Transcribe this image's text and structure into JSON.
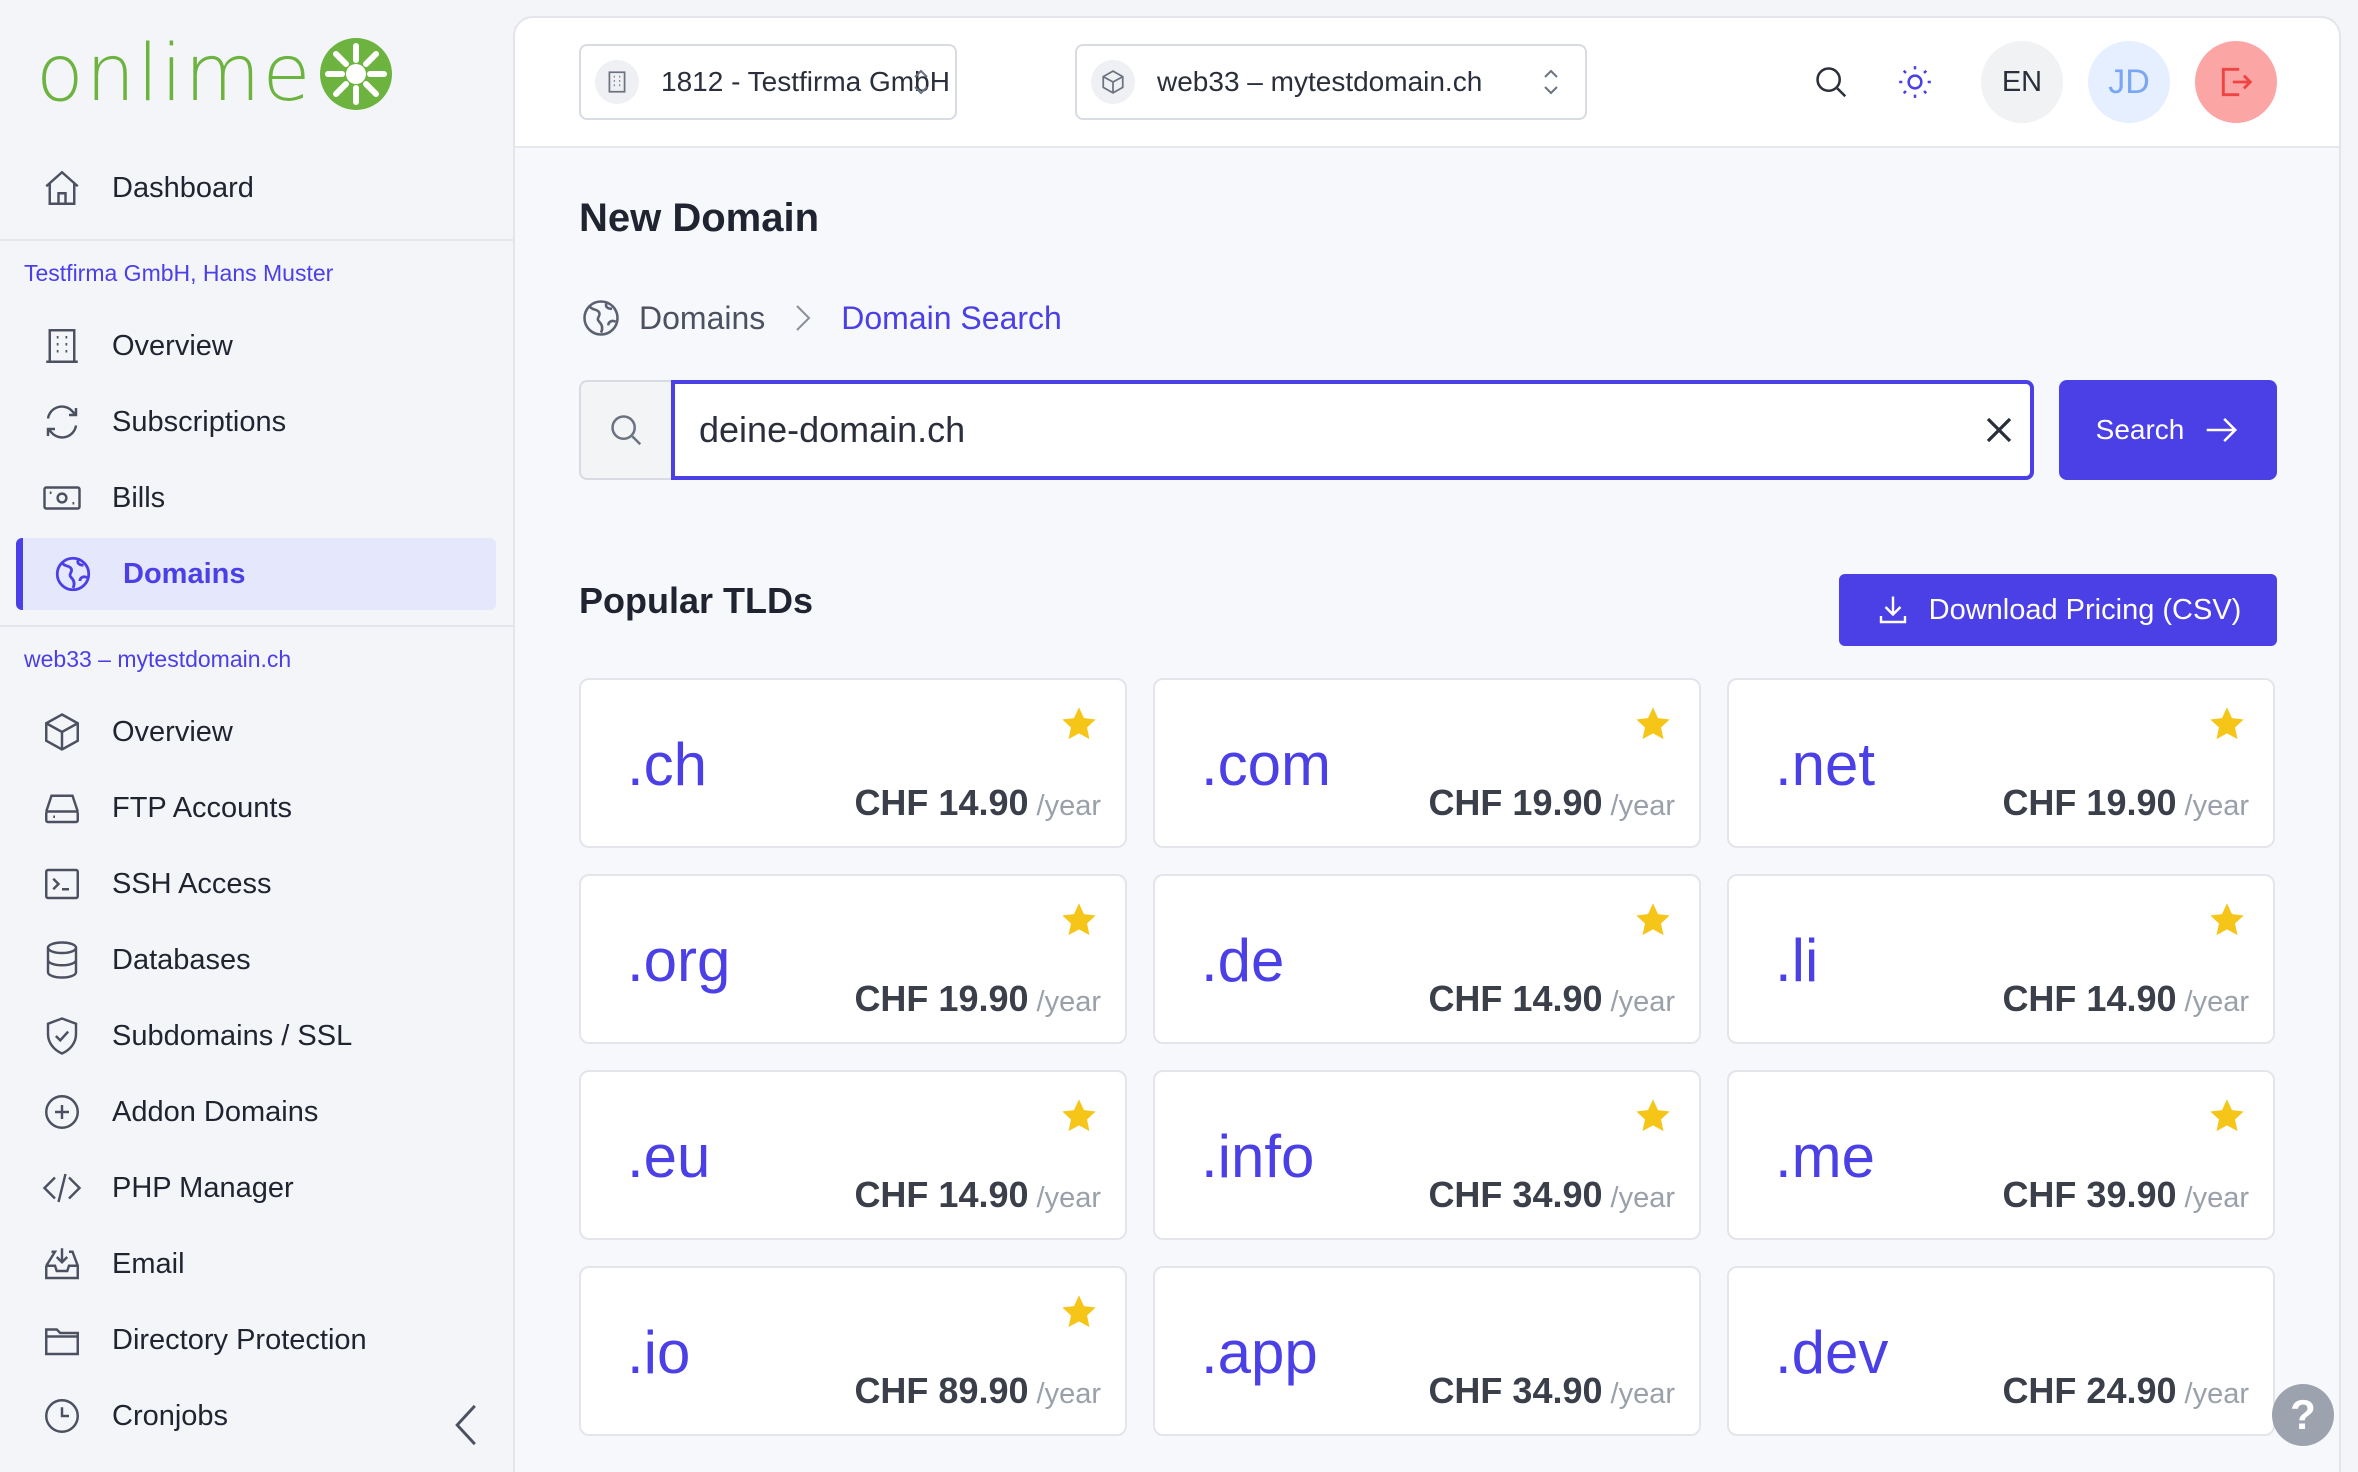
{
  "brand": {
    "logo_text": "onlime"
  },
  "sidebar": {
    "dashboard": "Dashboard",
    "customer_section": "Testfirma GmbH, Hans Muster",
    "customer_items": [
      {
        "label": "Overview",
        "icon": "building-icon"
      },
      {
        "label": "Subscriptions",
        "icon": "refresh-icon"
      },
      {
        "label": "Bills",
        "icon": "banknote-icon"
      },
      {
        "label": "Domains",
        "icon": "globe-icon",
        "active": true
      }
    ],
    "webspace_section": "web33 – mytestdomain.ch",
    "webspace_items": [
      {
        "label": "Overview",
        "icon": "cube-icon"
      },
      {
        "label": "FTP Accounts",
        "icon": "hard-drive-icon"
      },
      {
        "label": "SSH Access",
        "icon": "terminal-icon"
      },
      {
        "label": "Databases",
        "icon": "database-icon"
      },
      {
        "label": "Subdomains / SSL",
        "icon": "shield-check-icon"
      },
      {
        "label": "Addon Domains",
        "icon": "plus-circle-icon"
      },
      {
        "label": "PHP Manager",
        "icon": "code-icon"
      },
      {
        "label": "Email",
        "icon": "inbox-icon"
      },
      {
        "label": "Directory Protection",
        "icon": "folder-icon"
      },
      {
        "label": "Cronjobs",
        "icon": "clock-icon"
      }
    ]
  },
  "topbar": {
    "company_selector": "1812 - Testfirma GmbH",
    "webspace_selector": "web33 – mytestdomain.ch",
    "language": "EN",
    "user_initials": "JD"
  },
  "page": {
    "title": "New Domain",
    "breadcrumb": [
      "Domains",
      "Domain Search"
    ]
  },
  "search": {
    "value": "deine-domain.ch",
    "button_label": "Search"
  },
  "tlds": {
    "section_title": "Popular TLDs",
    "download_label": "Download Pricing (CSV)",
    "per_label": "/year",
    "items": [
      {
        "tld": ".ch",
        "price": "CHF 14.90",
        "starred": true
      },
      {
        "tld": ".com",
        "price": "CHF 19.90",
        "starred": true
      },
      {
        "tld": ".net",
        "price": "CHF 19.90",
        "starred": true
      },
      {
        "tld": ".org",
        "price": "CHF 19.90",
        "starred": true
      },
      {
        "tld": ".de",
        "price": "CHF 14.90",
        "starred": true
      },
      {
        "tld": ".li",
        "price": "CHF 14.90",
        "starred": true
      },
      {
        "tld": ".eu",
        "price": "CHF 14.90",
        "starred": true
      },
      {
        "tld": ".info",
        "price": "CHF 34.90",
        "starred": true
      },
      {
        "tld": ".me",
        "price": "CHF 39.90",
        "starred": true
      },
      {
        "tld": ".io",
        "price": "CHF 89.90",
        "starred": true
      },
      {
        "tld": ".app",
        "price": "CHF 34.90",
        "starred": false
      },
      {
        "tld": ".dev",
        "price": "CHF 24.90",
        "starred": false
      }
    ]
  },
  "help_label": "?",
  "colors": {
    "accent": "#4b3fe6",
    "brand_green": "#6db33f",
    "star": "#f5c518",
    "logout": "#ef4444"
  }
}
